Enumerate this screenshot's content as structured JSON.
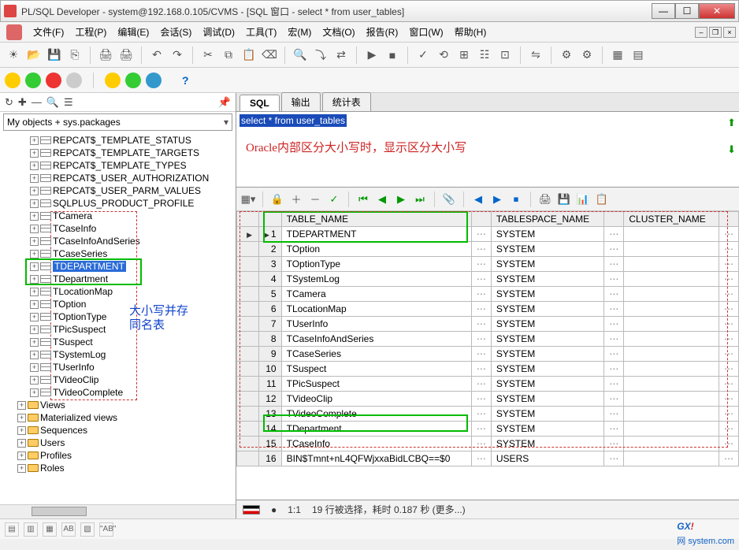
{
  "window": {
    "title": "PL/SQL Developer - system@192.168.0.105/CVMS - [SQL 窗口 - select * from user_tables]"
  },
  "menu": {
    "items": [
      "文件(F)",
      "工程(P)",
      "编辑(E)",
      "会话(S)",
      "调试(D)",
      "工具(T)",
      "宏(M)",
      "文档(O)",
      "报告(R)",
      "窗口(W)",
      "帮助(H)"
    ]
  },
  "sidebar": {
    "filter": "My objects + sys.packages",
    "tables": [
      "REPCAT$_TEMPLATE_STATUS",
      "REPCAT$_TEMPLATE_TARGETS",
      "REPCAT$_TEMPLATE_TYPES",
      "REPCAT$_USER_AUTHORIZATION",
      "REPCAT$_USER_PARM_VALUES",
      "SQLPLUS_PRODUCT_PROFILE",
      "TCamera",
      "TCaseInfo",
      "TCaseInfoAndSeries",
      "TCaseSeries",
      "TDEPARTMENT",
      "TDepartment",
      "TLocationMap",
      "TOption",
      "TOptionType",
      "TPicSuspect",
      "TSuspect",
      "TSystemLog",
      "TUserInfo",
      "TVideoClip",
      "TVideoComplete"
    ],
    "folders": [
      "Views",
      "Materialized views",
      "Sequences",
      "Users",
      "Profiles",
      "Roles"
    ],
    "selected_index": 10
  },
  "tabs": {
    "items": [
      "SQL",
      "输出",
      "统计表"
    ],
    "active": 0
  },
  "sql": {
    "text": "select * from user_tables",
    "annotation": "Oracle内部区分大小写时，显示区分大小写"
  },
  "tree_annotation": "大小写并存\n同名表",
  "grid": {
    "columns": [
      "TABLE_NAME",
      "TABLESPACE_NAME",
      "CLUSTER_NAME"
    ],
    "rows": [
      {
        "n": 1,
        "name": "TDEPARTMENT",
        "ts": "SYSTEM",
        "cl": ""
      },
      {
        "n": 2,
        "name": "TOption",
        "ts": "SYSTEM",
        "cl": ""
      },
      {
        "n": 3,
        "name": "TOptionType",
        "ts": "SYSTEM",
        "cl": ""
      },
      {
        "n": 4,
        "name": "TSystemLog",
        "ts": "SYSTEM",
        "cl": ""
      },
      {
        "n": 5,
        "name": "TCamera",
        "ts": "SYSTEM",
        "cl": ""
      },
      {
        "n": 6,
        "name": "TLocationMap",
        "ts": "SYSTEM",
        "cl": ""
      },
      {
        "n": 7,
        "name": "TUserInfo",
        "ts": "SYSTEM",
        "cl": ""
      },
      {
        "n": 8,
        "name": "TCaseInfoAndSeries",
        "ts": "SYSTEM",
        "cl": ""
      },
      {
        "n": 9,
        "name": "TCaseSeries",
        "ts": "SYSTEM",
        "cl": ""
      },
      {
        "n": 10,
        "name": "TSuspect",
        "ts": "SYSTEM",
        "cl": ""
      },
      {
        "n": 11,
        "name": "TPicSuspect",
        "ts": "SYSTEM",
        "cl": ""
      },
      {
        "n": 12,
        "name": "TVideoClip",
        "ts": "SYSTEM",
        "cl": ""
      },
      {
        "n": 13,
        "name": "TVideoComplete",
        "ts": "SYSTEM",
        "cl": ""
      },
      {
        "n": 14,
        "name": "TDepartment",
        "ts": "SYSTEM",
        "cl": ""
      },
      {
        "n": 15,
        "name": "TCaseInfo",
        "ts": "SYSTEM",
        "cl": ""
      },
      {
        "n": 16,
        "name": "BIN$Tmnt+nL4QFWjxxaBidLCBQ==$0",
        "ts": "USERS",
        "cl": ""
      }
    ]
  },
  "status": {
    "ratio": "1:1",
    "msg": "19 行被选择，耗时 0.187 秒 (更多...)"
  },
  "watermark": {
    "brand": "GXI",
    "site": "网 system.com"
  }
}
